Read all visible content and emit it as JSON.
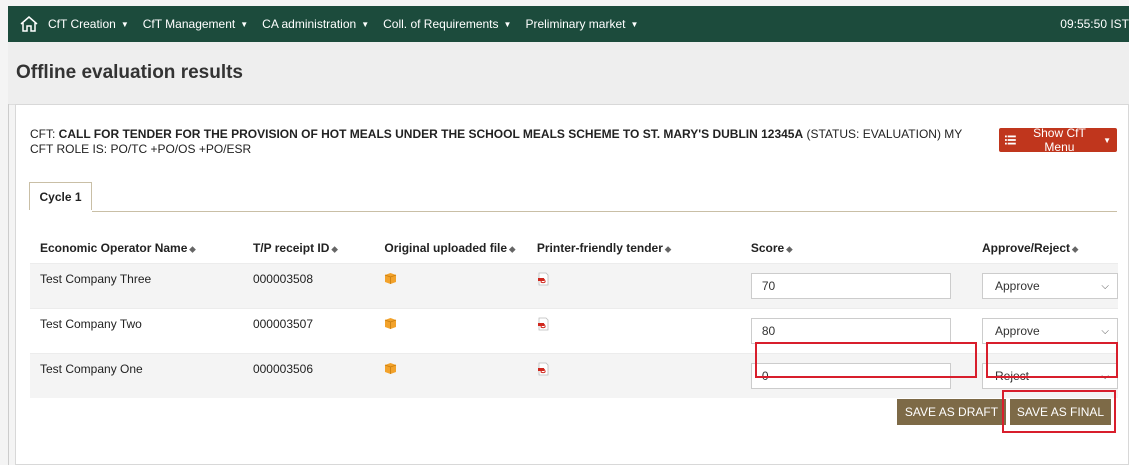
{
  "topbar": {
    "nav": [
      {
        "label": "CfT Creation"
      },
      {
        "label": "CfT Management"
      },
      {
        "label": "CA administration"
      },
      {
        "label": "Coll. of Requirements"
      },
      {
        "label": "Preliminary market"
      }
    ],
    "clock": "09:55:50 IST"
  },
  "page": {
    "title": "Offline evaluation results"
  },
  "cft": {
    "prefix": "CFT: ",
    "name": "CALL FOR TENDER FOR THE PROVISION OF HOT MEALS UNDER THE SCHOOL MEALS SCHEME TO ST. MARY'S DUBLIN 12345A",
    "status": " (STATUS: EVALUATION) MY CFT ROLE IS: PO/TC +PO/OS +PO/ESR",
    "menu_button": "Show CfT Menu"
  },
  "tabs": [
    {
      "label": "Cycle 1"
    }
  ],
  "table": {
    "headers": {
      "operator": "Economic Operator Name",
      "receipt": "T/P receipt ID",
      "original": "Original uploaded file",
      "printer": "Printer-friendly tender",
      "score": "Score",
      "approve": "Approve/Reject"
    },
    "rows": [
      {
        "operator": "Test Company Three",
        "receipt": "000003508",
        "score": "70",
        "decision": "Approve"
      },
      {
        "operator": "Test Company Two",
        "receipt": "000003507",
        "score": "80",
        "decision": "Approve"
      },
      {
        "operator": "Test Company One",
        "receipt": "000003506",
        "score": "0",
        "decision": "Reject"
      }
    ]
  },
  "actions": {
    "save_draft": "SAVE AS DRAFT",
    "save_final": "SAVE AS FINAL"
  },
  "colors": {
    "topbar": "#1c4b3c",
    "menu_button": "#c0361d",
    "action_button": "#7d6a47",
    "highlight": "#d81e2c"
  }
}
